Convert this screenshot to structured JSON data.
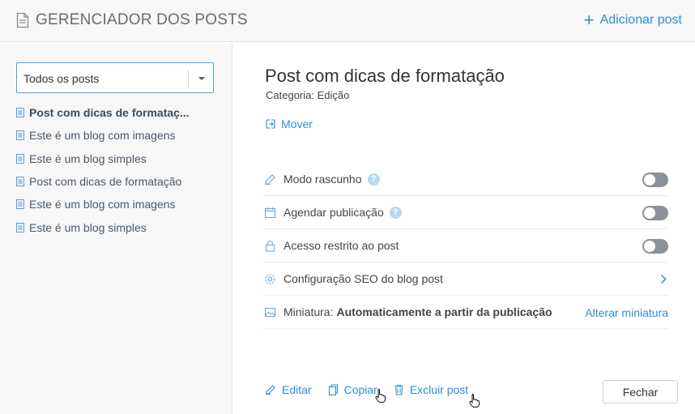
{
  "header": {
    "title": "GERENCIADOR DOS POSTS",
    "add_post_label": "Adicionar post",
    "accent_color": "#2b8fd6"
  },
  "sidebar": {
    "filter_selected": "Todos os posts",
    "posts": [
      {
        "label": "Post com dicas de formataç...",
        "active": true
      },
      {
        "label": "Este é um blog com imagens",
        "active": false
      },
      {
        "label": "Este é um blog simples",
        "active": false
      },
      {
        "label": "Post com dicas de formatação",
        "active": false
      },
      {
        "label": "Este é um blog com imagens",
        "active": false
      },
      {
        "label": "Este é um blog simples",
        "active": false
      }
    ]
  },
  "main": {
    "post_title": "Post com dicas de formatação",
    "category": "Categoria: Edição",
    "move_label": "Mover",
    "settings": {
      "draft_label": "Modo rascunho",
      "draft_on": false,
      "schedule_label": "Agendar publicação",
      "schedule_on": false,
      "restricted_label": "Acesso restrito ao post",
      "restricted_on": false,
      "seo_label": "Configuração SEO do blog post",
      "thumbnail_label": "Miniatura:",
      "thumbnail_value": "Automaticamente a partir da publicação",
      "change_thumbnail_label": "Alterar miniatura",
      "help_glyph": "?"
    },
    "actions": {
      "edit_label": "Editar",
      "copy_label": "Copiar",
      "delete_label": "Excluir post",
      "close_label": "Fechar"
    }
  }
}
